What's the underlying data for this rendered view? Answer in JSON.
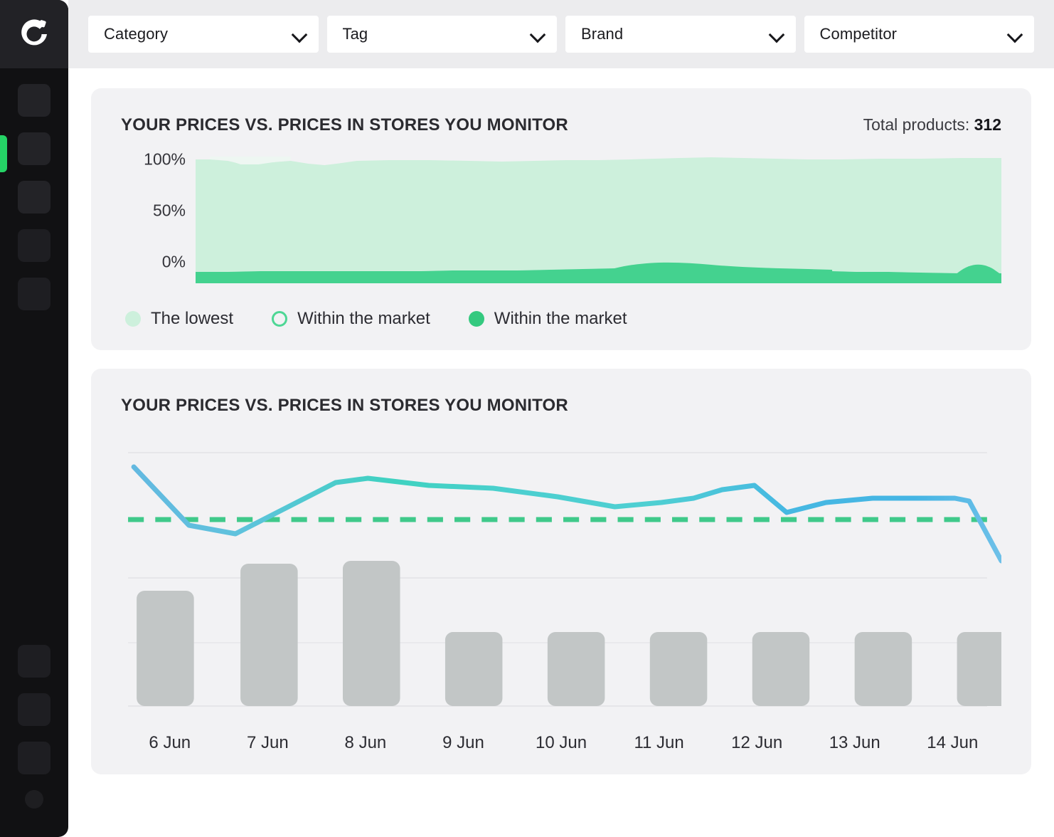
{
  "sidebar": {
    "logo_icon": "circular-c-logo-icon",
    "items": [
      {
        "name": "nav-item-1",
        "icon": "placeholder-square-icon"
      },
      {
        "name": "nav-item-2",
        "icon": "placeholder-square-icon"
      },
      {
        "name": "nav-item-3",
        "icon": "placeholder-square-icon"
      },
      {
        "name": "nav-item-4",
        "icon": "placeholder-square-icon"
      },
      {
        "name": "nav-item-5",
        "icon": "placeholder-square-icon"
      }
    ],
    "bottom_items": [
      {
        "name": "nav-bottom-1",
        "icon": "placeholder-square-icon"
      },
      {
        "name": "nav-bottom-2",
        "icon": "placeholder-square-icon"
      },
      {
        "name": "nav-bottom-3",
        "icon": "placeholder-square-icon"
      }
    ],
    "active_index": 1,
    "active_color": "#25d366",
    "background": "#111113"
  },
  "filters": [
    {
      "name": "filter-category",
      "label": "Category",
      "value": "Category"
    },
    {
      "name": "filter-tag",
      "label": "Tag",
      "value": "Tag"
    },
    {
      "name": "filter-brand",
      "label": "Brand",
      "value": "Brand"
    },
    {
      "name": "filter-competitor",
      "label": "Competitor",
      "value": "Competitor"
    }
  ],
  "card_area": {
    "title": "YOUR PRICES VS. PRICES IN STORES YOU MONITOR",
    "total_label": "Total products:",
    "total_value": "312",
    "legend": [
      {
        "label": "The lowest",
        "marker": "light",
        "color": "#cdf0dc"
      },
      {
        "label": "Within the market",
        "marker": "hollow",
        "color": "#4ed795"
      },
      {
        "label": "Within the market",
        "marker": "solid",
        "color": "#34c97f"
      }
    ]
  },
  "card_combo": {
    "title": "YOUR PRICES VS. PRICES IN STORES YOU MONITOR"
  },
  "chart_data": [
    {
      "type": "area",
      "title": "YOUR PRICES VS. PRICES IN STORES YOU MONITOR",
      "subtitle": "Total products: 312",
      "xlabel": "",
      "ylabel": "",
      "ylim": [
        0,
        100
      ],
      "yticks": [
        100,
        50,
        0
      ],
      "ytick_labels": [
        "100%",
        "50%",
        "0%"
      ],
      "grid": false,
      "legend_position": "bottom-left",
      "stacked": true,
      "x": [
        0,
        1,
        2,
        3,
        4,
        5,
        6,
        7,
        8,
        9,
        10,
        11,
        12,
        13,
        14,
        15,
        16,
        17,
        18,
        19,
        20,
        21,
        22,
        23,
        24
      ],
      "series": [
        {
          "name": "Within the market",
          "color": "#34c97f",
          "values": [
            4,
            4,
            4,
            4,
            4,
            4,
            4,
            4,
            4,
            5,
            5,
            4,
            5,
            6,
            7,
            6,
            5,
            5,
            6,
            6,
            5,
            5,
            7,
            6,
            8
          ]
        },
        {
          "name": "The lowest",
          "color": "#cdf0dc",
          "values": [
            96,
            96,
            93,
            93,
            96,
            96,
            96,
            95,
            95,
            93,
            92,
            94,
            95,
            93,
            92,
            93,
            94,
            95,
            94,
            94,
            95,
            94,
            92,
            93,
            92
          ]
        }
      ]
    },
    {
      "type": "bar+line",
      "title": "YOUR PRICES VS. PRICES IN STORES YOU MONITOR",
      "xlabel": "",
      "ylabel": "",
      "grid": true,
      "categories": [
        "6 Jun",
        "7 Jun",
        "8 Jun",
        "9 Jun",
        "10 Jun",
        "11 Jun",
        "12 Jun",
        "13 Jun",
        "14 Jun"
      ],
      "series": [
        {
          "name": "bars",
          "type": "bar",
          "color": "#c2c6c6",
          "values": [
            58,
            92,
            95,
            42,
            42,
            42,
            42,
            42,
            42
          ]
        },
        {
          "name": "your price",
          "type": "line",
          "color": "#41b6e6",
          "values": [
            88,
            50,
            60,
            92,
            90,
            87,
            88,
            84,
            30
          ]
        },
        {
          "name": "market average",
          "type": "line-dashed",
          "color": "#3fc98a",
          "values": [
            52,
            52,
            52,
            52,
            52,
            52,
            52,
            52,
            52
          ]
        }
      ]
    }
  ]
}
